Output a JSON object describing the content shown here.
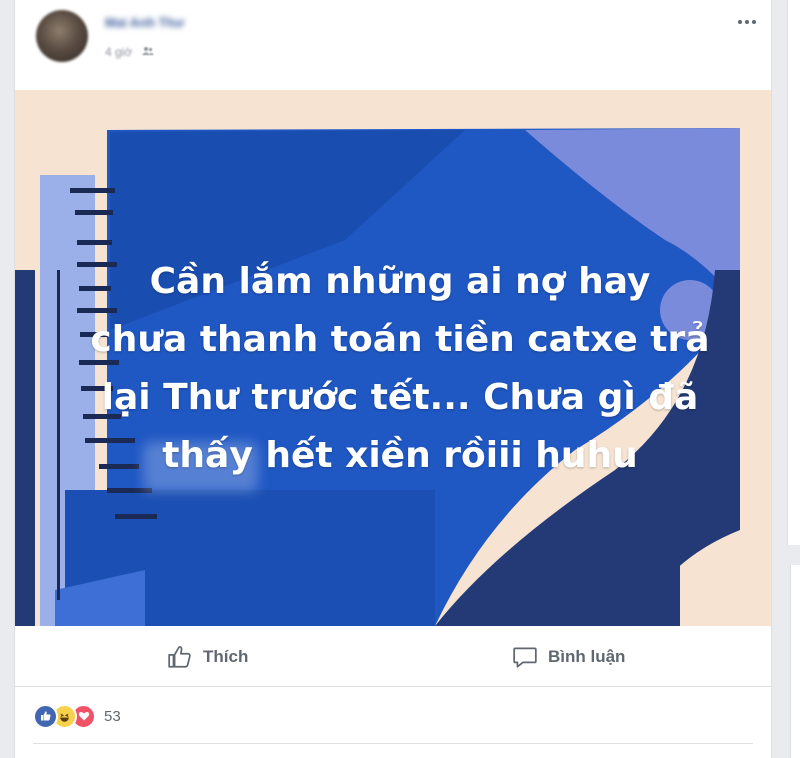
{
  "post": {
    "author": "Mai Anh Thư",
    "time": "4 giờ",
    "body_lines": [
      "Cần lắm những ai nợ hay",
      "chưa thanh toán tiền catxe trả",
      "lại Thư trước tết... Chưa gì đã",
      "thấy hết xiền rồiii huhu"
    ],
    "background_colors": {
      "peach": "#f6e3d2",
      "royal_blue": "#1f57c3",
      "navy": "#233a77",
      "periwinkle": "#7b8bdb",
      "dark_stripe": "#1a2a55"
    }
  },
  "actions": {
    "like_label": "Thích",
    "comment_label": "Bình luận"
  },
  "reactions": {
    "types": [
      "like-icon",
      "haha-icon",
      "love-icon"
    ],
    "count": "53"
  }
}
